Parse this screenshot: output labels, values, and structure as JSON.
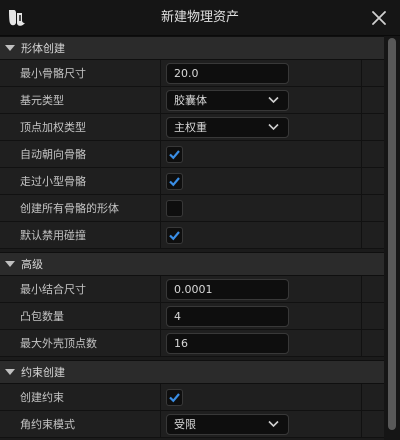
{
  "window": {
    "title": "新建物理资产"
  },
  "icons": {
    "logo": "unreal-logo-icon",
    "close": "close-icon",
    "collapse": "caret-down-icon",
    "dropdown": "chevron-down-icon",
    "check": "checkmark-icon"
  },
  "colors": {
    "accent_check": "#3a8ee6",
    "background": "#1b1b1b",
    "section": "#2b2b2b"
  },
  "sections": {
    "body_creation": {
      "label": "形体创建",
      "min_bone_size": {
        "label": "最小骨骼尺寸",
        "value": "20.0"
      },
      "primitive_type": {
        "label": "基元类型",
        "value": "胶囊体"
      },
      "vertex_weighting": {
        "label": "顶点加权类型",
        "value": "主权重"
      },
      "auto_orient": {
        "label": "自动朝向骨骼",
        "checked": true
      },
      "walk_past_small": {
        "label": "走过小型骨骼",
        "checked": true
      },
      "body_for_all": {
        "label": "创建所有骨骼的形体",
        "checked": false
      },
      "disable_collision": {
        "label": "默认禁用碰撞",
        "checked": true
      }
    },
    "advanced": {
      "label": "高级",
      "min_weld_size": {
        "label": "最小结合尺寸",
        "value": "0.0001"
      },
      "hull_count": {
        "label": "凸包数量",
        "value": "4"
      },
      "max_hull_verts": {
        "label": "最大外壳顶点数",
        "value": "16"
      }
    },
    "constraint_creation": {
      "label": "约束创建",
      "create_constraints": {
        "label": "创建约束",
        "checked": true
      },
      "angular_mode": {
        "label": "角约束模式",
        "value": "受限"
      }
    }
  }
}
